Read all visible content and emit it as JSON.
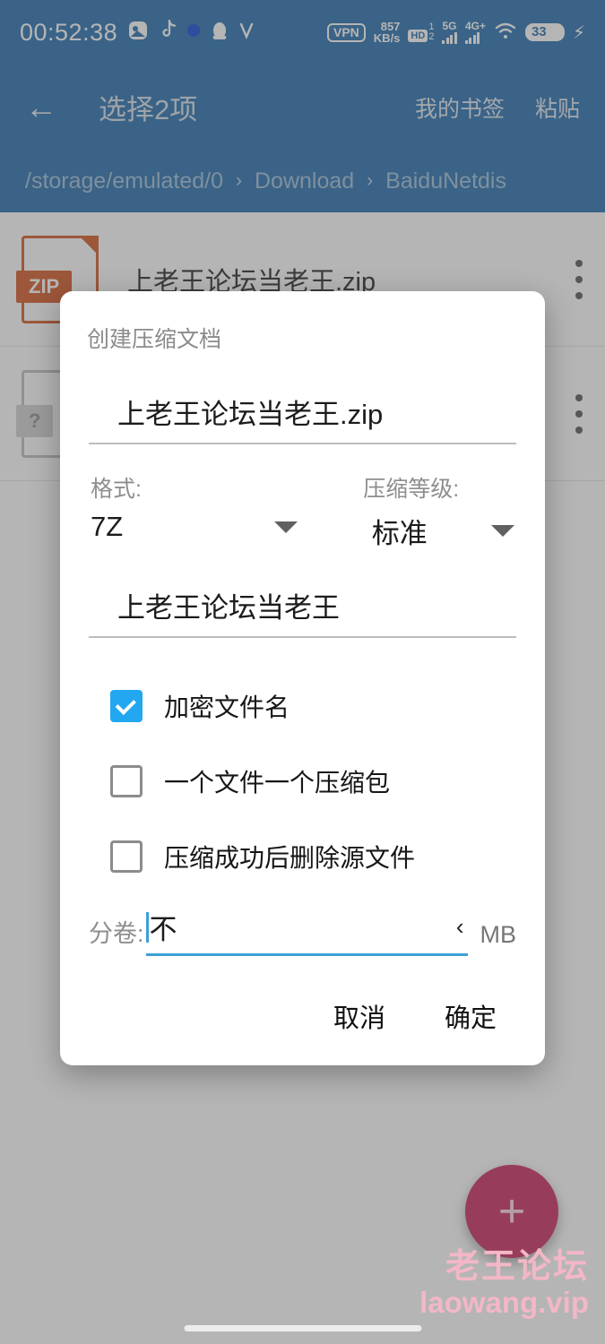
{
  "statusbar": {
    "time": "00:52:38",
    "app_icons": [
      "photos-icon",
      "tiktok-icon",
      "blue-dot-icon",
      "qq-penguin-icon",
      "v-app-icon"
    ],
    "vpn_label": "VPN",
    "net_speed_value": "857",
    "net_speed_unit": "KB/s",
    "hd_label": "HD",
    "hd_sup": "1",
    "hd_sub": "2",
    "sim1_label": "5G",
    "sim2_label": "4G+",
    "wifi_icon": "wifi-icon",
    "battery_level": "33",
    "charging_icon": "⚡"
  },
  "appbar": {
    "back_icon": "←",
    "title": "选择2项",
    "actions": [
      {
        "label": "我的书签",
        "name": "bookmarks-action"
      },
      {
        "label": "粘贴",
        "name": "paste-action"
      }
    ]
  },
  "breadcrumb": {
    "segments": [
      "/storage/emulated/0",
      "Download",
      "BaiduNetdis"
    ],
    "separator": "›"
  },
  "filelist": [
    {
      "name": "上老王论坛当老王.zip",
      "icon": "zip-file-icon",
      "tag": "ZIP"
    },
    {
      "name": "",
      "icon": "unknown-file-icon",
      "tag": "?"
    }
  ],
  "fab": {
    "icon": "+",
    "color": "#c9265c"
  },
  "watermark": {
    "line1": "老王论坛",
    "line2": "laowang.vip",
    "color": "#f3b7c6"
  },
  "dialog": {
    "title": "创建压缩文档",
    "filename": "上老王论坛当老王.zip",
    "format_label": "格式:",
    "format_value": "7Z",
    "level_label": "压缩等级:",
    "level_value": "标准",
    "password": "上老王论坛当老王",
    "checkboxes": [
      {
        "label": "加密文件名",
        "checked": true,
        "name": "encrypt-filenames-checkbox"
      },
      {
        "label": "一个文件一个压缩包",
        "checked": false,
        "name": "one-archive-per-file-checkbox"
      },
      {
        "label": "压缩成功后删除源文件",
        "checked": false,
        "name": "delete-source-after-checkbox"
      }
    ],
    "split_label": "分卷:",
    "split_value": "不",
    "split_chevron": "‹",
    "split_unit": "MB",
    "cancel_label": "取消",
    "confirm_label": "确定"
  },
  "theme": {
    "header_blue": "#1f6bab",
    "accent_blue": "#22a7f0",
    "zip_orange": "#d4541f"
  }
}
